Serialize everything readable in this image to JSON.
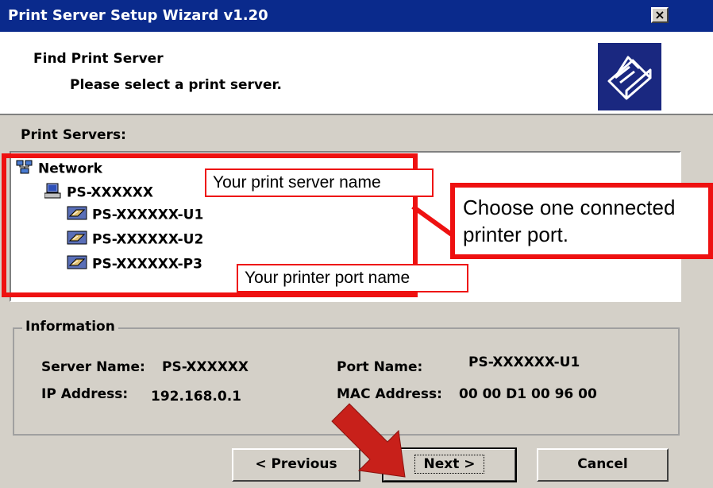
{
  "window": {
    "title": "Print Server Setup Wizard v1.20",
    "close_glyph": "×"
  },
  "header": {
    "heading": "Find Print Server",
    "subheading": "Please select a print server.",
    "icon": "printer-icon"
  },
  "servers_label": "Print Servers:",
  "tree": {
    "root": "Network",
    "server": "PS-XXXXXX",
    "ports": [
      "PS-XXXXXX-U1",
      "PS-XXXXXX-U2",
      "PS-XXXXXX-P3"
    ]
  },
  "annotations": {
    "server_name": "Your print server name",
    "port_name": "Your printer port name",
    "choose_line1": "Choose one connected",
    "choose_line2": "printer port."
  },
  "information": {
    "legend": "Information",
    "server_name_label": "Server Name:",
    "server_name_value": "PS-XXXXXX",
    "port_name_label": "Port Name:",
    "port_name_value": "PS-XXXXXX-U1",
    "ip_label": "IP Address:",
    "ip_value": "192.168.0.1",
    "mac_label": "MAC Address:",
    "mac_value": "00 00 D1 00 96 00"
  },
  "buttons": {
    "previous": "< Previous",
    "next": "Next >",
    "cancel": "Cancel"
  },
  "colors": {
    "title_bar": "#0a2a8c",
    "dialog": "#d4d0c8",
    "highlight_red": "#ee1111",
    "arrow_red": "#c8201a"
  }
}
